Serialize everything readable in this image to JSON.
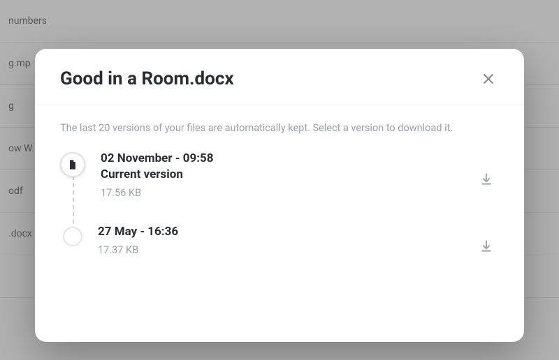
{
  "background_rows": [
    "numbers",
    "g.mp",
    "g",
    "ow W",
    "odf",
    ".docx",
    ""
  ],
  "dialog": {
    "title": "Good in a Room.docx",
    "help_text": "The last 20 versions of your files are automatically kept. Select a version to download it.",
    "versions": [
      {
        "date": "02 November - 09:58",
        "label": "Current version",
        "size": "17.56 KB",
        "is_current": true
      },
      {
        "date": "27 May - 16:36",
        "label": "",
        "size": "17.37 KB",
        "is_current": false
      }
    ]
  }
}
